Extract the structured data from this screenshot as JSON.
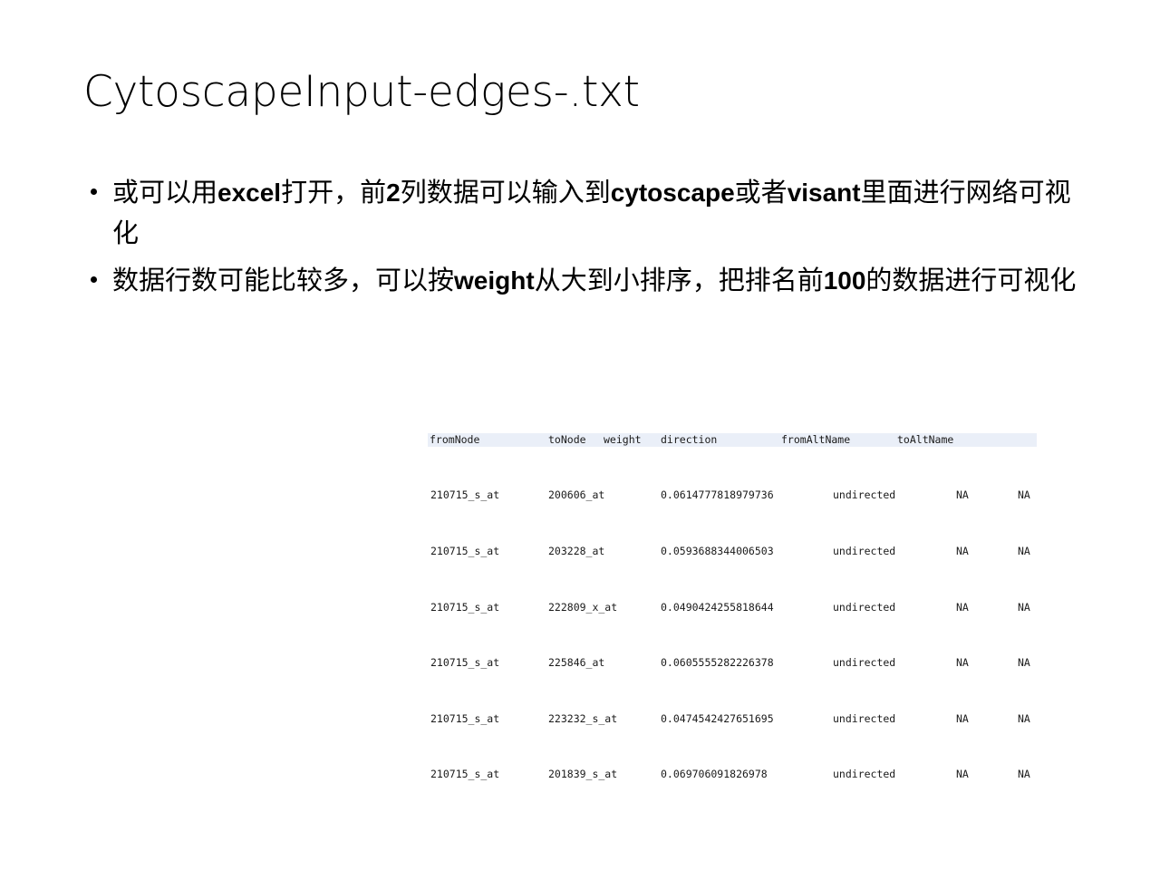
{
  "slide": {
    "title": "CytoscapeInput-edges-.txt",
    "bullets": [
      {
        "marker": "•",
        "segments": [
          {
            "text": "或可以用",
            "latin": false
          },
          {
            "text": "excel",
            "latin": true
          },
          {
            "text": "打开，前",
            "latin": false
          },
          {
            "text": "2",
            "latin": true
          },
          {
            "text": "列数据可以输入到",
            "latin": false
          },
          {
            "text": "cytoscape",
            "latin": true
          },
          {
            "text": "或者",
            "latin": false
          },
          {
            "text": "visant",
            "latin": true
          },
          {
            "text": "里面进行网络可视化",
            "latin": false
          }
        ],
        "plain": "或可以用excel打开，前2列数据可以输入到cytoscape或者visant里面进行网络可视化"
      },
      {
        "marker": "•",
        "segments": [
          {
            "text": "数据行数可能比较多，可以按",
            "latin": false
          },
          {
            "text": "weight",
            "latin": true
          },
          {
            "text": "从大到小排序，把排名前",
            "latin": false
          },
          {
            "text": "100",
            "latin": true
          },
          {
            "text": "的数据进行可视化",
            "latin": false
          }
        ],
        "plain": "数据行数可能比较多，可以按weight从大到小排序，把排名前100的数据进行可视化"
      }
    ]
  },
  "edge_table": {
    "header_background": "#eaeff8",
    "columns": [
      "fromNode",
      "toNode",
      "weight",
      "direction",
      "fromAltName",
      "toAltName"
    ],
    "rows": [
      {
        "fromNode": "210715_s_at",
        "toNode": "200606_at",
        "weight": "0.0614777818979736",
        "direction": "undirected",
        "fromAltName": "NA",
        "toAltName": "NA"
      },
      {
        "fromNode": "210715_s_at",
        "toNode": "203228_at",
        "weight": "0.0593688344006503",
        "direction": "undirected",
        "fromAltName": "NA",
        "toAltName": "NA"
      },
      {
        "fromNode": "210715_s_at",
        "toNode": "222809_x_at",
        "weight": "0.0490424255818644",
        "direction": "undirected",
        "fromAltName": "NA",
        "toAltName": "NA"
      },
      {
        "fromNode": "210715_s_at",
        "toNode": "225846_at",
        "weight": "0.0605555282226378",
        "direction": "undirected",
        "fromAltName": "NA",
        "toAltName": "NA"
      },
      {
        "fromNode": "210715_s_at",
        "toNode": "223232_s_at",
        "weight": "0.0474542427651695",
        "direction": "undirected",
        "fromAltName": "NA",
        "toAltName": "NA"
      },
      {
        "fromNode": "210715_s_at",
        "toNode": "201839_s_at",
        "weight": "0.069706091826978",
        "direction": "undirected",
        "fromAltName": "NA",
        "toAltName": "NA"
      }
    ]
  }
}
